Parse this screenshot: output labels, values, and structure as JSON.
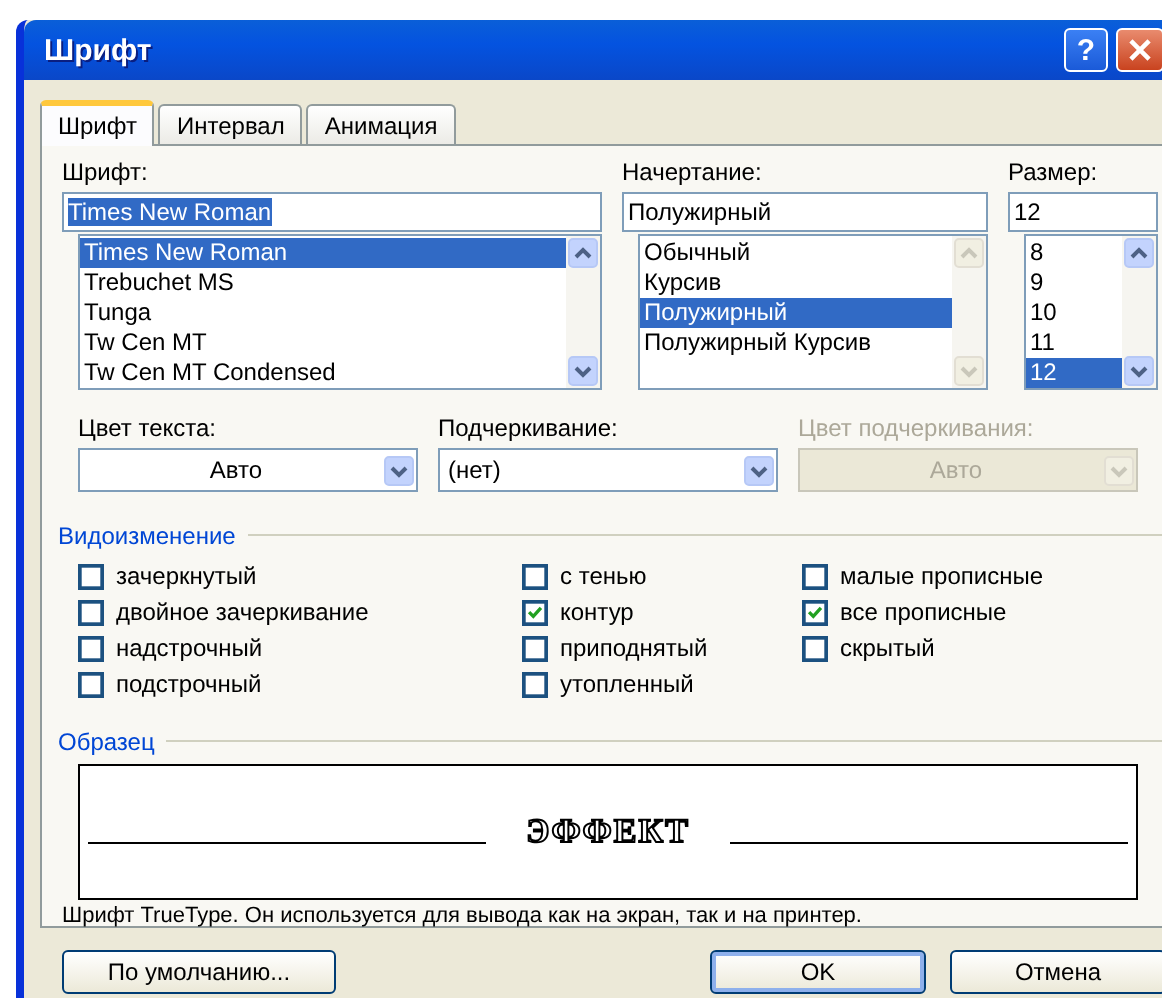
{
  "window": {
    "title": "Шрифт",
    "help": "?"
  },
  "tabs": [
    {
      "label": "Шрифт",
      "selected": true
    },
    {
      "label": "Интервал",
      "selected": false
    },
    {
      "label": "Анимация",
      "selected": false
    }
  ],
  "pickers": [
    {
      "label": "Шрифт:",
      "value": "Times New Roman",
      "value_highlighted": true,
      "scrollbar_disabled": false,
      "items": [
        {
          "label": "Times New Roman",
          "selected": true
        },
        {
          "label": "Trebuchet MS",
          "selected": false
        },
        {
          "label": "Tunga",
          "selected": false
        },
        {
          "label": "Tw Cen MT",
          "selected": false
        },
        {
          "label": "Tw Cen MT Condensed",
          "selected": false
        }
      ]
    },
    {
      "label": "Начертание:",
      "value": "Полужирный",
      "value_highlighted": false,
      "scrollbar_disabled": true,
      "items": [
        {
          "label": "Обычный",
          "selected": false
        },
        {
          "label": "Курсив",
          "selected": false
        },
        {
          "label": "Полужирный",
          "selected": true
        },
        {
          "label": "Полужирный Курсив",
          "selected": false
        }
      ]
    },
    {
      "label": "Размер:",
      "value": "12",
      "value_highlighted": false,
      "scrollbar_disabled": false,
      "items": [
        {
          "label": "8",
          "selected": false
        },
        {
          "label": "9",
          "selected": false
        },
        {
          "label": "10",
          "selected": false
        },
        {
          "label": "11",
          "selected": false
        },
        {
          "label": "12",
          "selected": true
        }
      ]
    }
  ],
  "combos": [
    {
      "kind": "color",
      "label": "Цвет текста:",
      "value": "Авто",
      "disabled": false
    },
    {
      "kind": "list",
      "label": "Подчеркивание:",
      "value": "(нет)",
      "disabled": false
    },
    {
      "kind": "color",
      "label": "Цвет подчеркивания:",
      "value": "Авто",
      "disabled": true
    }
  ],
  "effects": {
    "title": "Видоизменение",
    "columns": [
      [
        {
          "label": "зачеркнутый",
          "checked": false
        },
        {
          "label": "двойное зачеркивание",
          "checked": false
        },
        {
          "label": "надстрочный",
          "checked": false
        },
        {
          "label": "подстрочный",
          "checked": false
        }
      ],
      [
        {
          "label": "с тенью",
          "checked": false
        },
        {
          "label": "контур",
          "checked": true
        },
        {
          "label": "приподнятый",
          "checked": false
        },
        {
          "label": "утопленный",
          "checked": false
        }
      ],
      [
        {
          "label": "малые прописные",
          "checked": false
        },
        {
          "label": "все прописные",
          "checked": true
        },
        {
          "label": "скрытый",
          "checked": false
        }
      ]
    ]
  },
  "sample": {
    "title": "Образец",
    "preview": "ЭФФЕКТ",
    "note": "Шрифт TrueType. Он используется для вывода как на экран, так и на принтер."
  },
  "buttons": [
    {
      "label": "По умолчанию...",
      "default": false
    },
    {
      "label": "OK",
      "default": true
    },
    {
      "label": "Отмена",
      "default": false
    }
  ]
}
